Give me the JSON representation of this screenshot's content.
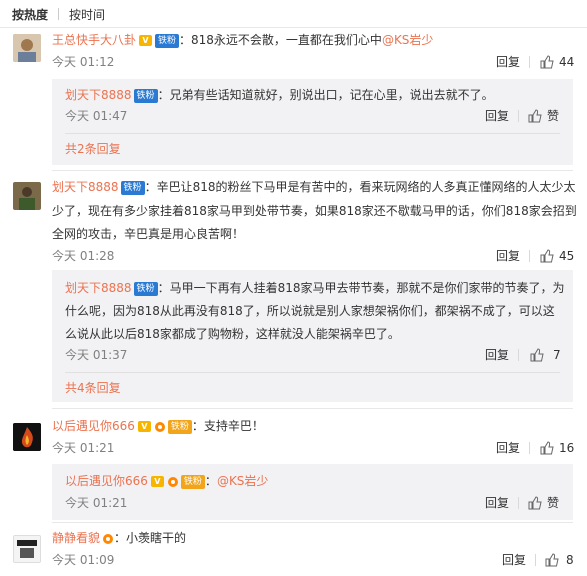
{
  "tabs": {
    "hot": "按热度",
    "time": "按时间"
  },
  "comments": [
    {
      "user": "王总快手大八卦",
      "fan_badge": "铁粉",
      "text": "：818永远不会散，一直都在我们心中",
      "mention": "@KS岩少",
      "time": "今天 01:12",
      "reply_label": "回复",
      "likes": "44",
      "replies": [
        {
          "user": "划天下8888",
          "fan_badge": "铁粉",
          "text": "：兄弟有些话知道就好，别说出口，记在心里，说出去就不了。",
          "time": "今天 01:47",
          "reply_label": "回复",
          "like_label": "赞"
        }
      ],
      "more": "共2条回复"
    },
    {
      "user": "划天下8888",
      "fan_badge": "铁粉",
      "text_lines": [
        "：辛巴让818的粉丝下马甲是有苦中的，看来玩网络的人多真正懂网络的人太少太",
        "少了，现在有多少家挂着818家马甲到处带节奏，如果818家还不歇载马甲的话，你们818家会招到",
        "全网的攻击，辛巴真是用心良苦啊！"
      ],
      "time": "今天 01:28",
      "reply_label": "回复",
      "likes": "45",
      "replies": [
        {
          "user": "划天下8888",
          "fan_badge": "铁粉",
          "text_lines": [
            "：马甲一下再有人挂着818家马甲去带节奏，那就不是你们家带的节奏了，为",
            "什么呢，因为818从此再没有818了，所以说就是别人家想架祸你们，都架祸不成了，可以这",
            "么说从此以后818家都成了购物粉，这样就没人能架祸辛巴了。"
          ],
          "time": "今天 01:37",
          "reply_label": "回复",
          "likes": "7"
        }
      ],
      "more": "共4条回复"
    },
    {
      "user": "以后遇见你666",
      "fan_badge": "铁粉",
      "text": "：支持辛巴！",
      "time": "今天 01:21",
      "reply_label": "回复",
      "likes": "16",
      "replies": [
        {
          "user": "以后遇见你666",
          "fan_badge": "铁粉",
          "text": "：",
          "mention": "@KS岩少",
          "time": "今天 01:21",
          "reply_label": "回复",
          "like_label": "赞"
        }
      ]
    },
    {
      "user": "静静看貌",
      "text": "：小羡瞎干的",
      "time": "今天 01:09",
      "reply_label": "回复",
      "likes": "8"
    }
  ],
  "colors": {
    "accent": "#eb7350",
    "reply_bg": "#f2f2f5",
    "fan": "#2a7ad3",
    "vip": "#f7b500"
  }
}
